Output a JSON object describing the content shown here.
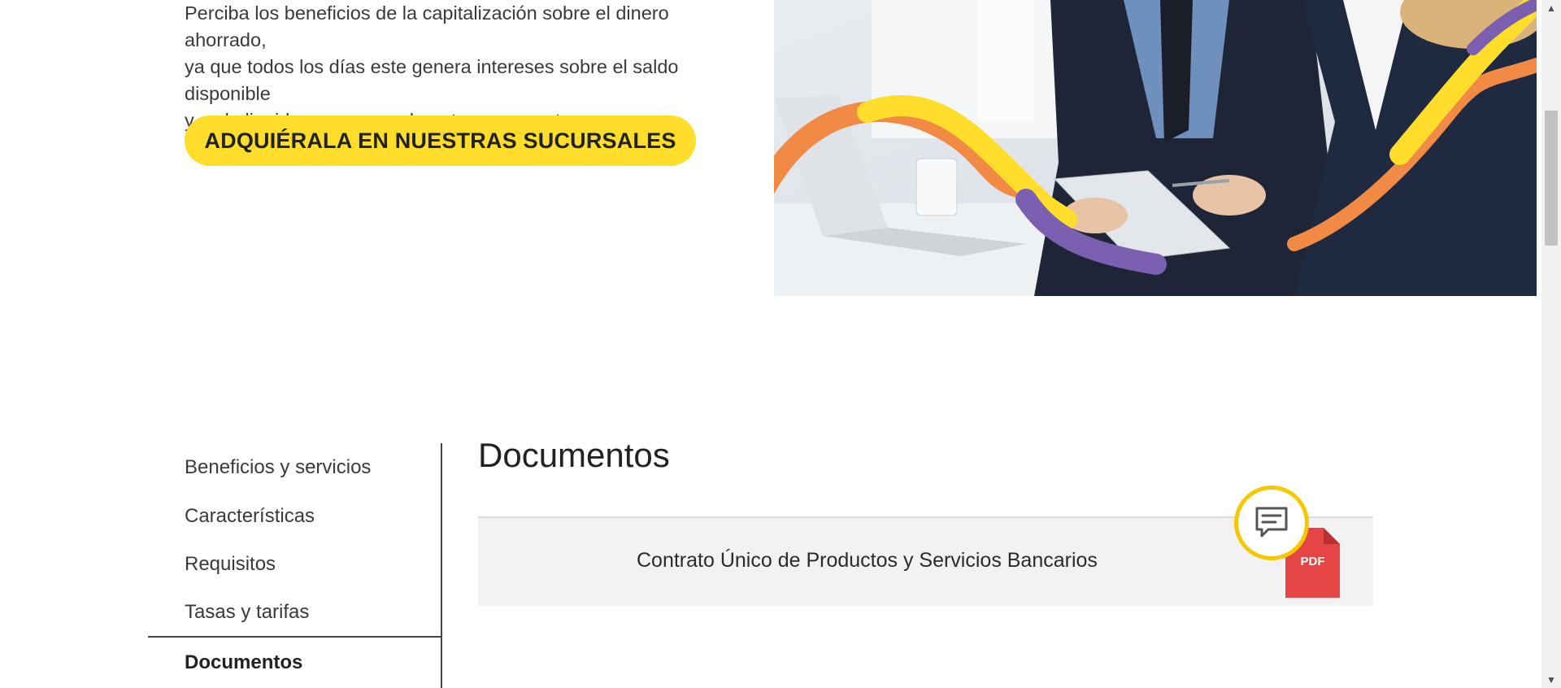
{
  "intro": {
    "lines": [
      "Perciba los beneficios de la capitalización sobre el dinero ahorrado,",
      "ya que todos los días este genera intereses sobre el saldo disponible",
      "y se lo liquidamos mensualmente a su cuenta."
    ]
  },
  "cta": {
    "label": "ADQUIÉRALA EN NUESTRAS SUCURSALES"
  },
  "sidenav": {
    "items": [
      {
        "label": "Beneficios y servicios"
      },
      {
        "label": "Características"
      },
      {
        "label": "Requisitos"
      },
      {
        "label": "Tasas y tarifas"
      },
      {
        "label": "Documentos",
        "active": true
      }
    ]
  },
  "documents": {
    "title": "Documentos",
    "items": [
      {
        "name": "Contrato Único de Productos y Servicios Bancarios",
        "file_type": "PDF"
      }
    ]
  },
  "colors": {
    "brand_yellow": "#fedd2b",
    "chat_ring": "#f5c800",
    "pdf_red": "#e54545",
    "wave_orange": "#f08a45",
    "wave_purple": "#7b5fb0"
  },
  "icons": {
    "chat": "chat-bubble-icon",
    "pdf": "pdf-file-icon",
    "scroll_up": "arrow-up-icon",
    "scroll_down": "arrow-down-icon"
  }
}
